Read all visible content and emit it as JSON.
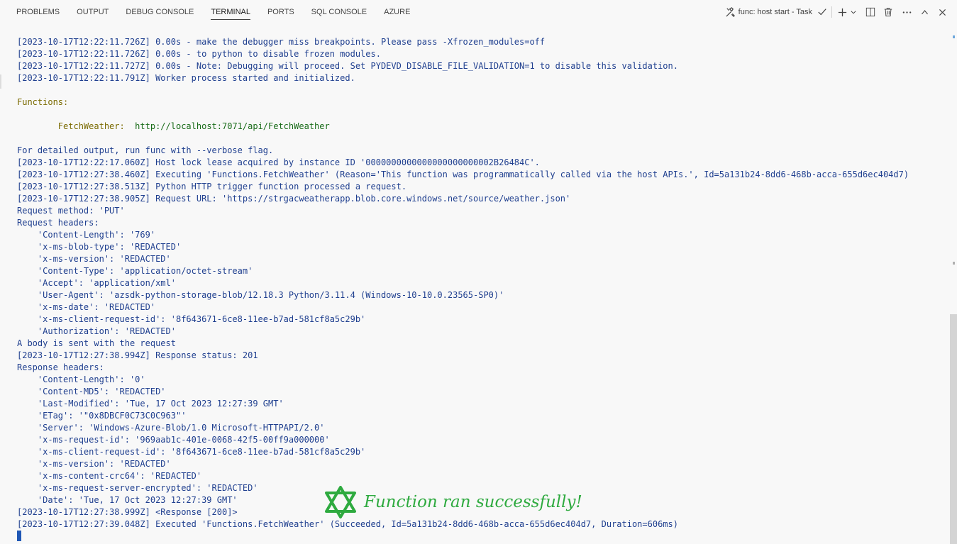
{
  "tabs": [
    "PROBLEMS",
    "OUTPUT",
    "DEBUG CONSOLE",
    "TERMINAL",
    "PORTS",
    "SQL CONSOLE",
    "AZURE"
  ],
  "active_tab_index": 3,
  "task": {
    "label": "func: host start - Task"
  },
  "icons": {
    "task": "tools-icon",
    "check": "check-icon",
    "add": "plus-icon",
    "dropdown": "chevron-down-icon",
    "split": "split-terminal-icon",
    "kill": "trash-icon",
    "more": "more-icon",
    "maximize": "chevron-up-icon",
    "close": "close-icon",
    "banner": "star-icon"
  },
  "terminal": {
    "lines": [
      {
        "text": "[2023-10-17T12:22:11.726Z] 0.00s - make the debugger miss breakpoints. Please pass -Xfrozen_modules=off",
        "style": ""
      },
      {
        "text": "[2023-10-17T12:22:11.726Z] 0.00s - to python to disable frozen modules.",
        "style": ""
      },
      {
        "text": "[2023-10-17T12:22:11.727Z] 0.00s - Note: Debugging will proceed. Set PYDEVD_DISABLE_FILE_VALIDATION=1 to disable this validation.",
        "style": ""
      },
      {
        "text": "[2023-10-17T12:22:11.791Z] Worker process started and initialized.",
        "style": ""
      },
      {
        "text": "",
        "style": "blank"
      },
      {
        "text": "Functions:",
        "style": "yellow"
      },
      {
        "text": "",
        "style": "blank"
      },
      {
        "text": "        FetchWeather:  http://localhost:7071/api/FetchWeather",
        "style": "function"
      },
      {
        "text": "",
        "style": "blank"
      },
      {
        "text": "For detailed output, run func with --verbose flag.",
        "style": ""
      },
      {
        "text": "[2023-10-17T12:22:17.060Z] Host lock lease acquired by instance ID '0000000000000000000000002B26484C'.",
        "style": ""
      },
      {
        "text": "[2023-10-17T12:27:38.460Z] Executing 'Functions.FetchWeather' (Reason='This function was programmatically called via the host APIs.', Id=5a131b24-8dd6-468b-acca-655d6ec404d7)",
        "style": ""
      },
      {
        "text": "[2023-10-17T12:27:38.513Z] Python HTTP trigger function processed a request.",
        "style": ""
      },
      {
        "text": "[2023-10-17T12:27:38.905Z] Request URL: 'https://strgacweatherapp.blob.core.windows.net/source/weather.json'",
        "style": ""
      },
      {
        "text": "Request method: 'PUT'",
        "style": ""
      },
      {
        "text": "Request headers:",
        "style": ""
      },
      {
        "text": "    'Content-Length': '769'",
        "style": ""
      },
      {
        "text": "    'x-ms-blob-type': 'REDACTED'",
        "style": ""
      },
      {
        "text": "    'x-ms-version': 'REDACTED'",
        "style": ""
      },
      {
        "text": "    'Content-Type': 'application/octet-stream'",
        "style": ""
      },
      {
        "text": "    'Accept': 'application/xml'",
        "style": ""
      },
      {
        "text": "    'User-Agent': 'azsdk-python-storage-blob/12.18.3 Python/3.11.4 (Windows-10-10.0.23565-SP0)'",
        "style": ""
      },
      {
        "text": "    'x-ms-date': 'REDACTED'",
        "style": ""
      },
      {
        "text": "    'x-ms-client-request-id': '8f643671-6ce8-11ee-b7ad-581cf8a5c29b'",
        "style": ""
      },
      {
        "text": "    'Authorization': 'REDACTED'",
        "style": ""
      },
      {
        "text": "A body is sent with the request",
        "style": ""
      },
      {
        "text": "[2023-10-17T12:27:38.994Z] Response status: 201",
        "style": ""
      },
      {
        "text": "Response headers:",
        "style": ""
      },
      {
        "text": "    'Content-Length': '0'",
        "style": ""
      },
      {
        "text": "    'Content-MD5': 'REDACTED'",
        "style": ""
      },
      {
        "text": "    'Last-Modified': 'Tue, 17 Oct 2023 12:27:39 GMT'",
        "style": ""
      },
      {
        "text": "    'ETag': '\"0x8DBCF0C73C0C963\"'",
        "style": ""
      },
      {
        "text": "    'Server': 'Windows-Azure-Blob/1.0 Microsoft-HTTPAPI/2.0'",
        "style": ""
      },
      {
        "text": "    'x-ms-request-id': '969aab1c-401e-0068-42f5-00ff9a000000'",
        "style": ""
      },
      {
        "text": "    'x-ms-client-request-id': '8f643671-6ce8-11ee-b7ad-581cf8a5c29b'",
        "style": ""
      },
      {
        "text": "    'x-ms-version': 'REDACTED'",
        "style": ""
      },
      {
        "text": "    'x-ms-content-crc64': 'REDACTED'",
        "style": ""
      },
      {
        "text": "    'x-ms-request-server-encrypted': 'REDACTED'",
        "style": ""
      },
      {
        "text": "    'Date': 'Tue, 17 Oct 2023 12:27:39 GMT'",
        "style": ""
      },
      {
        "text": "[2023-10-17T12:27:38.999Z] <Response [200]>",
        "style": ""
      },
      {
        "text": "[2023-10-17T12:27:39.048Z] Executed 'Functions.FetchWeather' (Succeeded, Id=5a131b24-8dd6-468b-acca-655d6ec404d7, Duration=606ms)",
        "style": ""
      }
    ]
  },
  "banner": {
    "text": "Function ran successfully!",
    "color": "#2eaa3f"
  },
  "colors": {
    "terminal_text": "#1f3f8f",
    "heading": "#7a6a00",
    "url": "#186b18",
    "cursor": "#1f57b5"
  }
}
